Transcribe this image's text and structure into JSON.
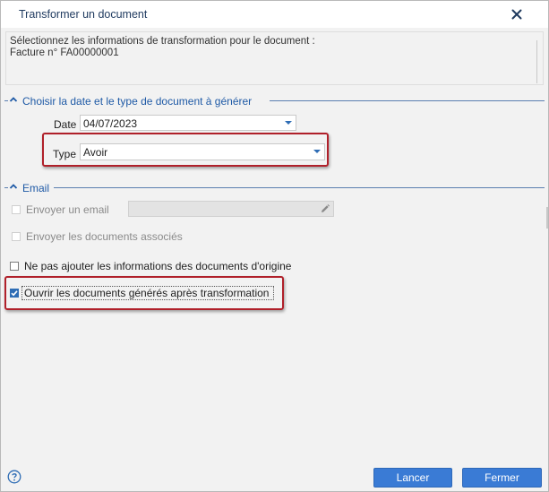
{
  "window": {
    "title": "Transformer un document"
  },
  "info": {
    "line1": "Sélectionnez les informations de transformation pour le document :",
    "line2": "Facture n° FA00000001"
  },
  "section_date_type": {
    "title": "Choisir la date et le type de document à générer",
    "date_label": "Date",
    "date_value": "04/07/2023",
    "type_label": "Type",
    "type_value": "Avoir"
  },
  "section_email": {
    "title": "Email",
    "send_email_label": "Envoyer un email",
    "send_email_checked": false,
    "email_value": "",
    "send_linked_label": "Envoyer les documents associés",
    "send_linked_checked": false
  },
  "options": {
    "no_origin_info_label": "Ne pas ajouter les informations des documents d'origine",
    "no_origin_info_checked": false,
    "open_generated_label": "Ouvrir les documents générés après transformation",
    "open_generated_checked": true
  },
  "footer": {
    "cancel_label": "Lancer",
    "close_label": "Fermer"
  },
  "icons": {
    "close": "close-icon",
    "help": "help-icon",
    "collapse": "chevron-up-icon",
    "dropdown": "chevron-down-icon",
    "edit": "pencil-icon",
    "check": "check-icon"
  },
  "colors": {
    "accent": "#3a7bd5",
    "section_title": "#1f5aa6",
    "highlight": "#b0202a"
  }
}
